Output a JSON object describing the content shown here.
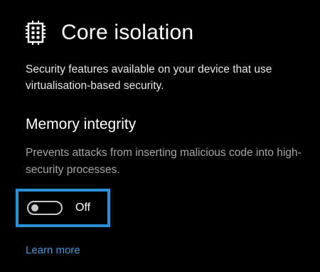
{
  "header": {
    "icon": "chip-icon",
    "title": "Core isolation"
  },
  "intro": {
    "text": "Security features available on your device that use virtualisation-based security."
  },
  "memory_integrity": {
    "title": "Memory integrity",
    "description": "Prevents attacks from inserting malicious code into high-security processes.",
    "toggle_state": "Off"
  },
  "links": {
    "learn_more": "Learn more"
  },
  "colors": {
    "background": "#000000",
    "highlight_border": "#2a8fd6",
    "link": "#3a9ad9",
    "secondary_text": "#a6a6a6"
  }
}
